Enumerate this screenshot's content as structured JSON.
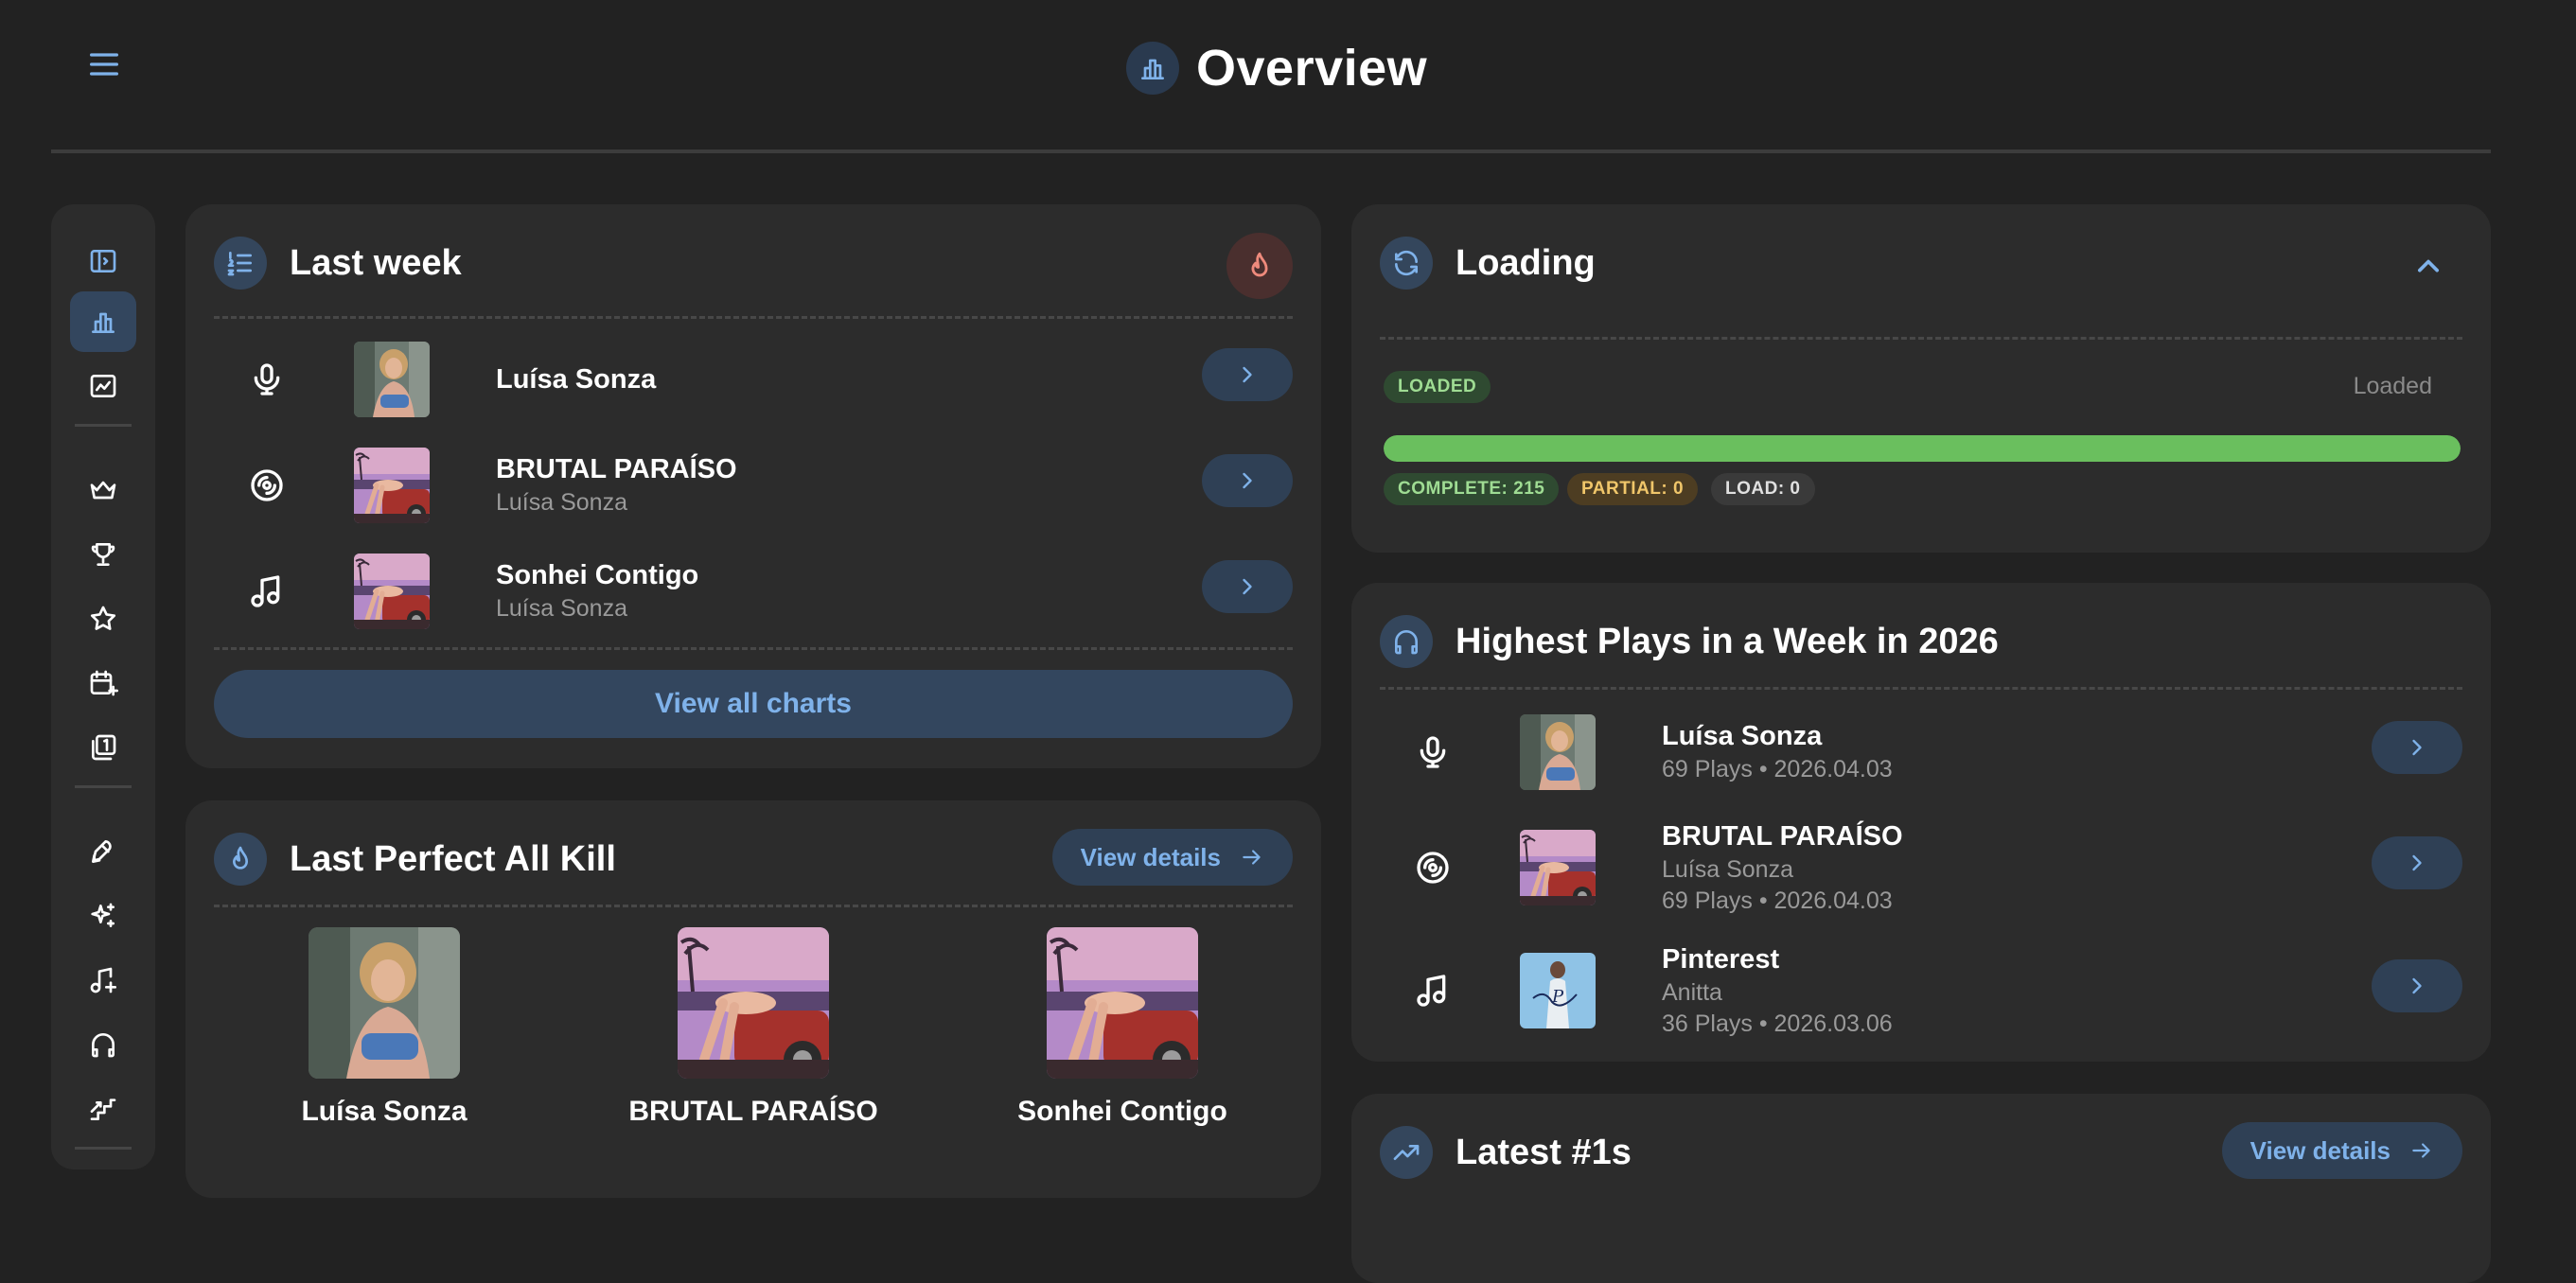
{
  "header": {
    "title": "Overview",
    "icons": {
      "menu": "menu-icon",
      "title": "bar-chart-icon"
    }
  },
  "sidebar": {
    "items": [
      {
        "icon": "sidebar-toggle-icon",
        "active": false
      },
      {
        "icon": "bar-chart-icon",
        "active": true
      },
      {
        "icon": "line-chart-icon",
        "active": false
      },
      {
        "icon": "crown-icon",
        "active": false
      },
      {
        "icon": "trophy-icon",
        "active": false
      },
      {
        "icon": "star-icon",
        "active": false
      },
      {
        "icon": "calendar-plus-icon",
        "active": false
      },
      {
        "icon": "number-one-stack-icon",
        "active": false
      },
      {
        "icon": "rocket-icon",
        "active": false
      },
      {
        "icon": "sparkles-icon",
        "active": false
      },
      {
        "icon": "music-plus-icon",
        "active": false
      },
      {
        "icon": "headphones-icon",
        "active": false
      },
      {
        "icon": "stairs-up-icon",
        "active": false
      }
    ]
  },
  "last_week": {
    "title": "Last week",
    "rows": [
      {
        "kind": "artist",
        "icon": "microphone-icon",
        "name": "Luísa Sonza",
        "sub": ""
      },
      {
        "kind": "album",
        "icon": "disc-icon",
        "name": "BRUTAL PARAÍSO",
        "sub": "Luísa Sonza"
      },
      {
        "kind": "track",
        "icon": "music-note-icon",
        "name": "Sonhei Contigo",
        "sub": "Luísa Sonza"
      }
    ],
    "view_all_label": "View all charts"
  },
  "perfect_all_kill": {
    "title": "Last Perfect All Kill",
    "view_details_label": "View details",
    "items": [
      {
        "label": "Luísa Sonza"
      },
      {
        "label": "BRUTAL PARAÍSO"
      },
      {
        "label": "Sonhei Contigo"
      }
    ]
  },
  "loading": {
    "title": "Loading",
    "status_badge": "LOADED",
    "status_text": "Loaded",
    "progress": 1.0,
    "complete_label": "COMPLETE: 215",
    "partial_label": "PARTIAL: 0",
    "load_label": "LOAD: 0",
    "colors": {
      "progress": "#6abf5e",
      "complete_bg": "#2f4a31",
      "partial_bg": "#4d3d22"
    }
  },
  "highest_plays": {
    "title": "Highest Plays in a Week in 2026",
    "rows": [
      {
        "kind": "artist",
        "icon": "microphone-icon",
        "name": "Luísa Sonza",
        "sub1": "69 Plays • 2026.04.03",
        "sub2": ""
      },
      {
        "kind": "album",
        "icon": "disc-icon",
        "name": "BRUTAL PARAÍSO",
        "sub1": "Luísa Sonza",
        "sub2": "69 Plays • 2026.04.03"
      },
      {
        "kind": "track",
        "icon": "music-note-icon",
        "name": "Pinterest",
        "sub1": "Anitta",
        "sub2": "36 Plays • 2026.03.06"
      }
    ]
  },
  "latest_ones": {
    "title": "Latest #1s",
    "view_details_label": "View details"
  }
}
